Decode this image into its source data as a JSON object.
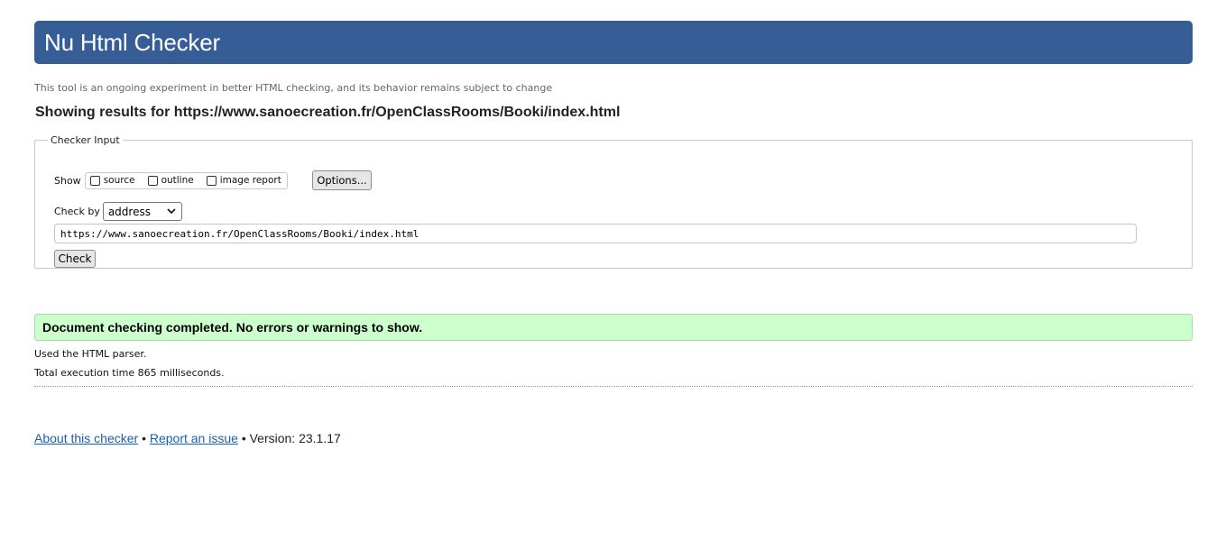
{
  "header": {
    "title": "Nu Html Checker"
  },
  "tagline": "This tool is an ongoing experiment in better HTML checking, and its behavior remains subject to change",
  "results": {
    "prefix": "Showing results for",
    "url": "https://www.sanoecreation.fr/OpenClassRooms/Booki/index.html"
  },
  "checker_input": {
    "legend": "Checker Input",
    "show_label": "Show",
    "checkboxes": [
      {
        "label": "source",
        "checked": false
      },
      {
        "label": "outline",
        "checked": false
      },
      {
        "label": "image report",
        "checked": false
      }
    ],
    "options_button": "Options...",
    "check_by_label": "Check by",
    "check_by_value": "address",
    "url_value": "https://www.sanoecreation.fr/OpenClassRooms/Booki/index.html",
    "check_button": "Check"
  },
  "status": {
    "message": "Document checking completed. No errors or warnings to show.",
    "color": "#ccffcc"
  },
  "details": {
    "parser": "Used the HTML parser.",
    "execution": "Total execution time 865 milliseconds."
  },
  "footer": {
    "about_link": "About this checker",
    "separator": "•",
    "report_link": "Report an issue",
    "version": "Version: 23.1.17"
  },
  "colors": {
    "header_bg": "#365d95",
    "link": "#1a5fb4"
  },
  "icons": {
    "select_arrow": "chevron-down-icon"
  }
}
